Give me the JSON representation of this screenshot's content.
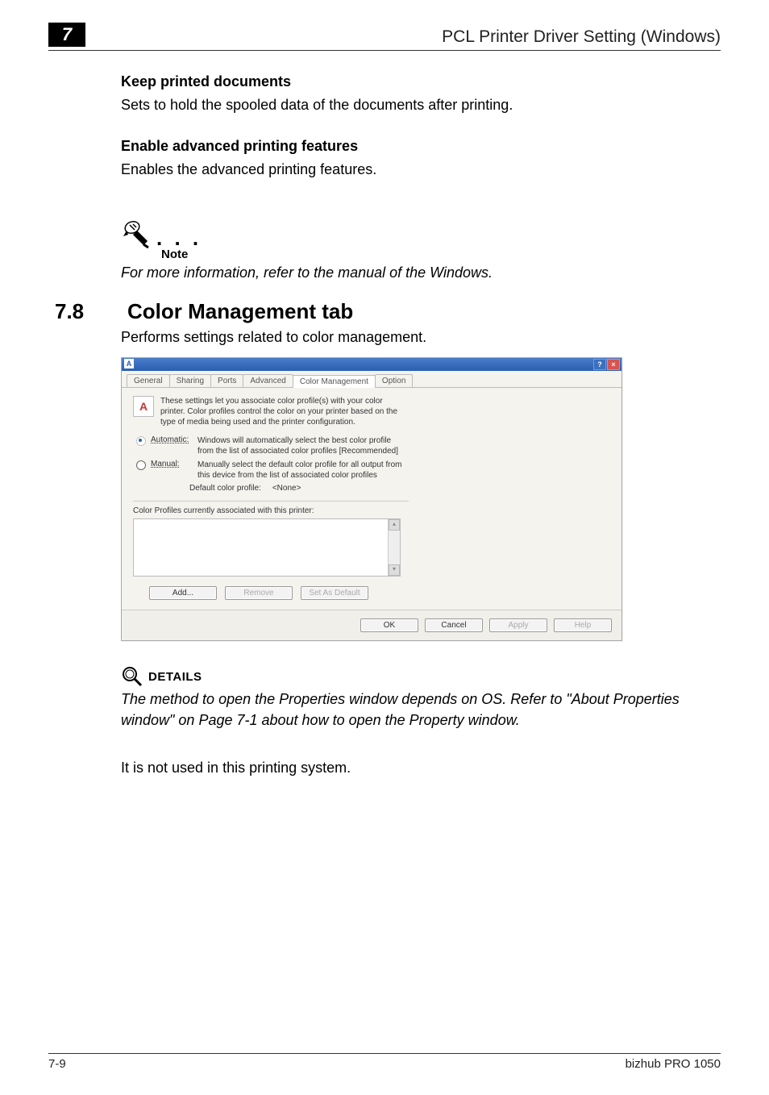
{
  "header": {
    "chapter_number": "7",
    "title": "PCL Printer Driver Setting (Windows)"
  },
  "blocks": {
    "keep_head": "Keep printed documents",
    "keep_body": "Sets to hold the spooled data of the documents after printing.",
    "enable_head": "Enable advanced printing features",
    "enable_body": "Enables the advanced printing features."
  },
  "note": {
    "label": "Note",
    "text": "For more information, refer to the manual of the Windows."
  },
  "section": {
    "number": "7.8",
    "title": "Color Management tab",
    "sub": "Performs settings related to color management."
  },
  "screenshot": {
    "tabs": {
      "general": "General",
      "sharing": "Sharing",
      "ports": "Ports",
      "advanced": "Advanced",
      "color_mgmt": "Color Management",
      "option": "Option"
    },
    "info": "These settings let you associate color profile(s) with your color printer. Color profiles control the color on your printer based on the type of media being used and the printer configuration.",
    "auto_label": "Automatic:",
    "auto_desc": "Windows will automatically select the best color profile from the list of associated color profiles [Recommended]",
    "manual_label": "Manual:",
    "manual_desc": "Manually select the default color profile for all output from this device from the list of associated color profiles",
    "default_profile_label": "Default color profile:",
    "default_profile_value": "<None>",
    "assoc_label": "Color Profiles currently associated with this printer:",
    "btn_add": "Add...",
    "btn_remove": "Remove",
    "btn_setdef": "Set As Default",
    "btn_ok": "OK",
    "btn_cancel": "Cancel",
    "btn_apply": "Apply",
    "btn_help": "Help"
  },
  "details": {
    "label": "DETAILS",
    "text": "The method to open the Properties window depends on OS. Refer to \"About Properties window\" on Page 7-1 about how to open the Property window."
  },
  "final": "It is not used in this printing system.",
  "footer": {
    "left": "7-9",
    "right": "bizhub PRO 1050"
  }
}
